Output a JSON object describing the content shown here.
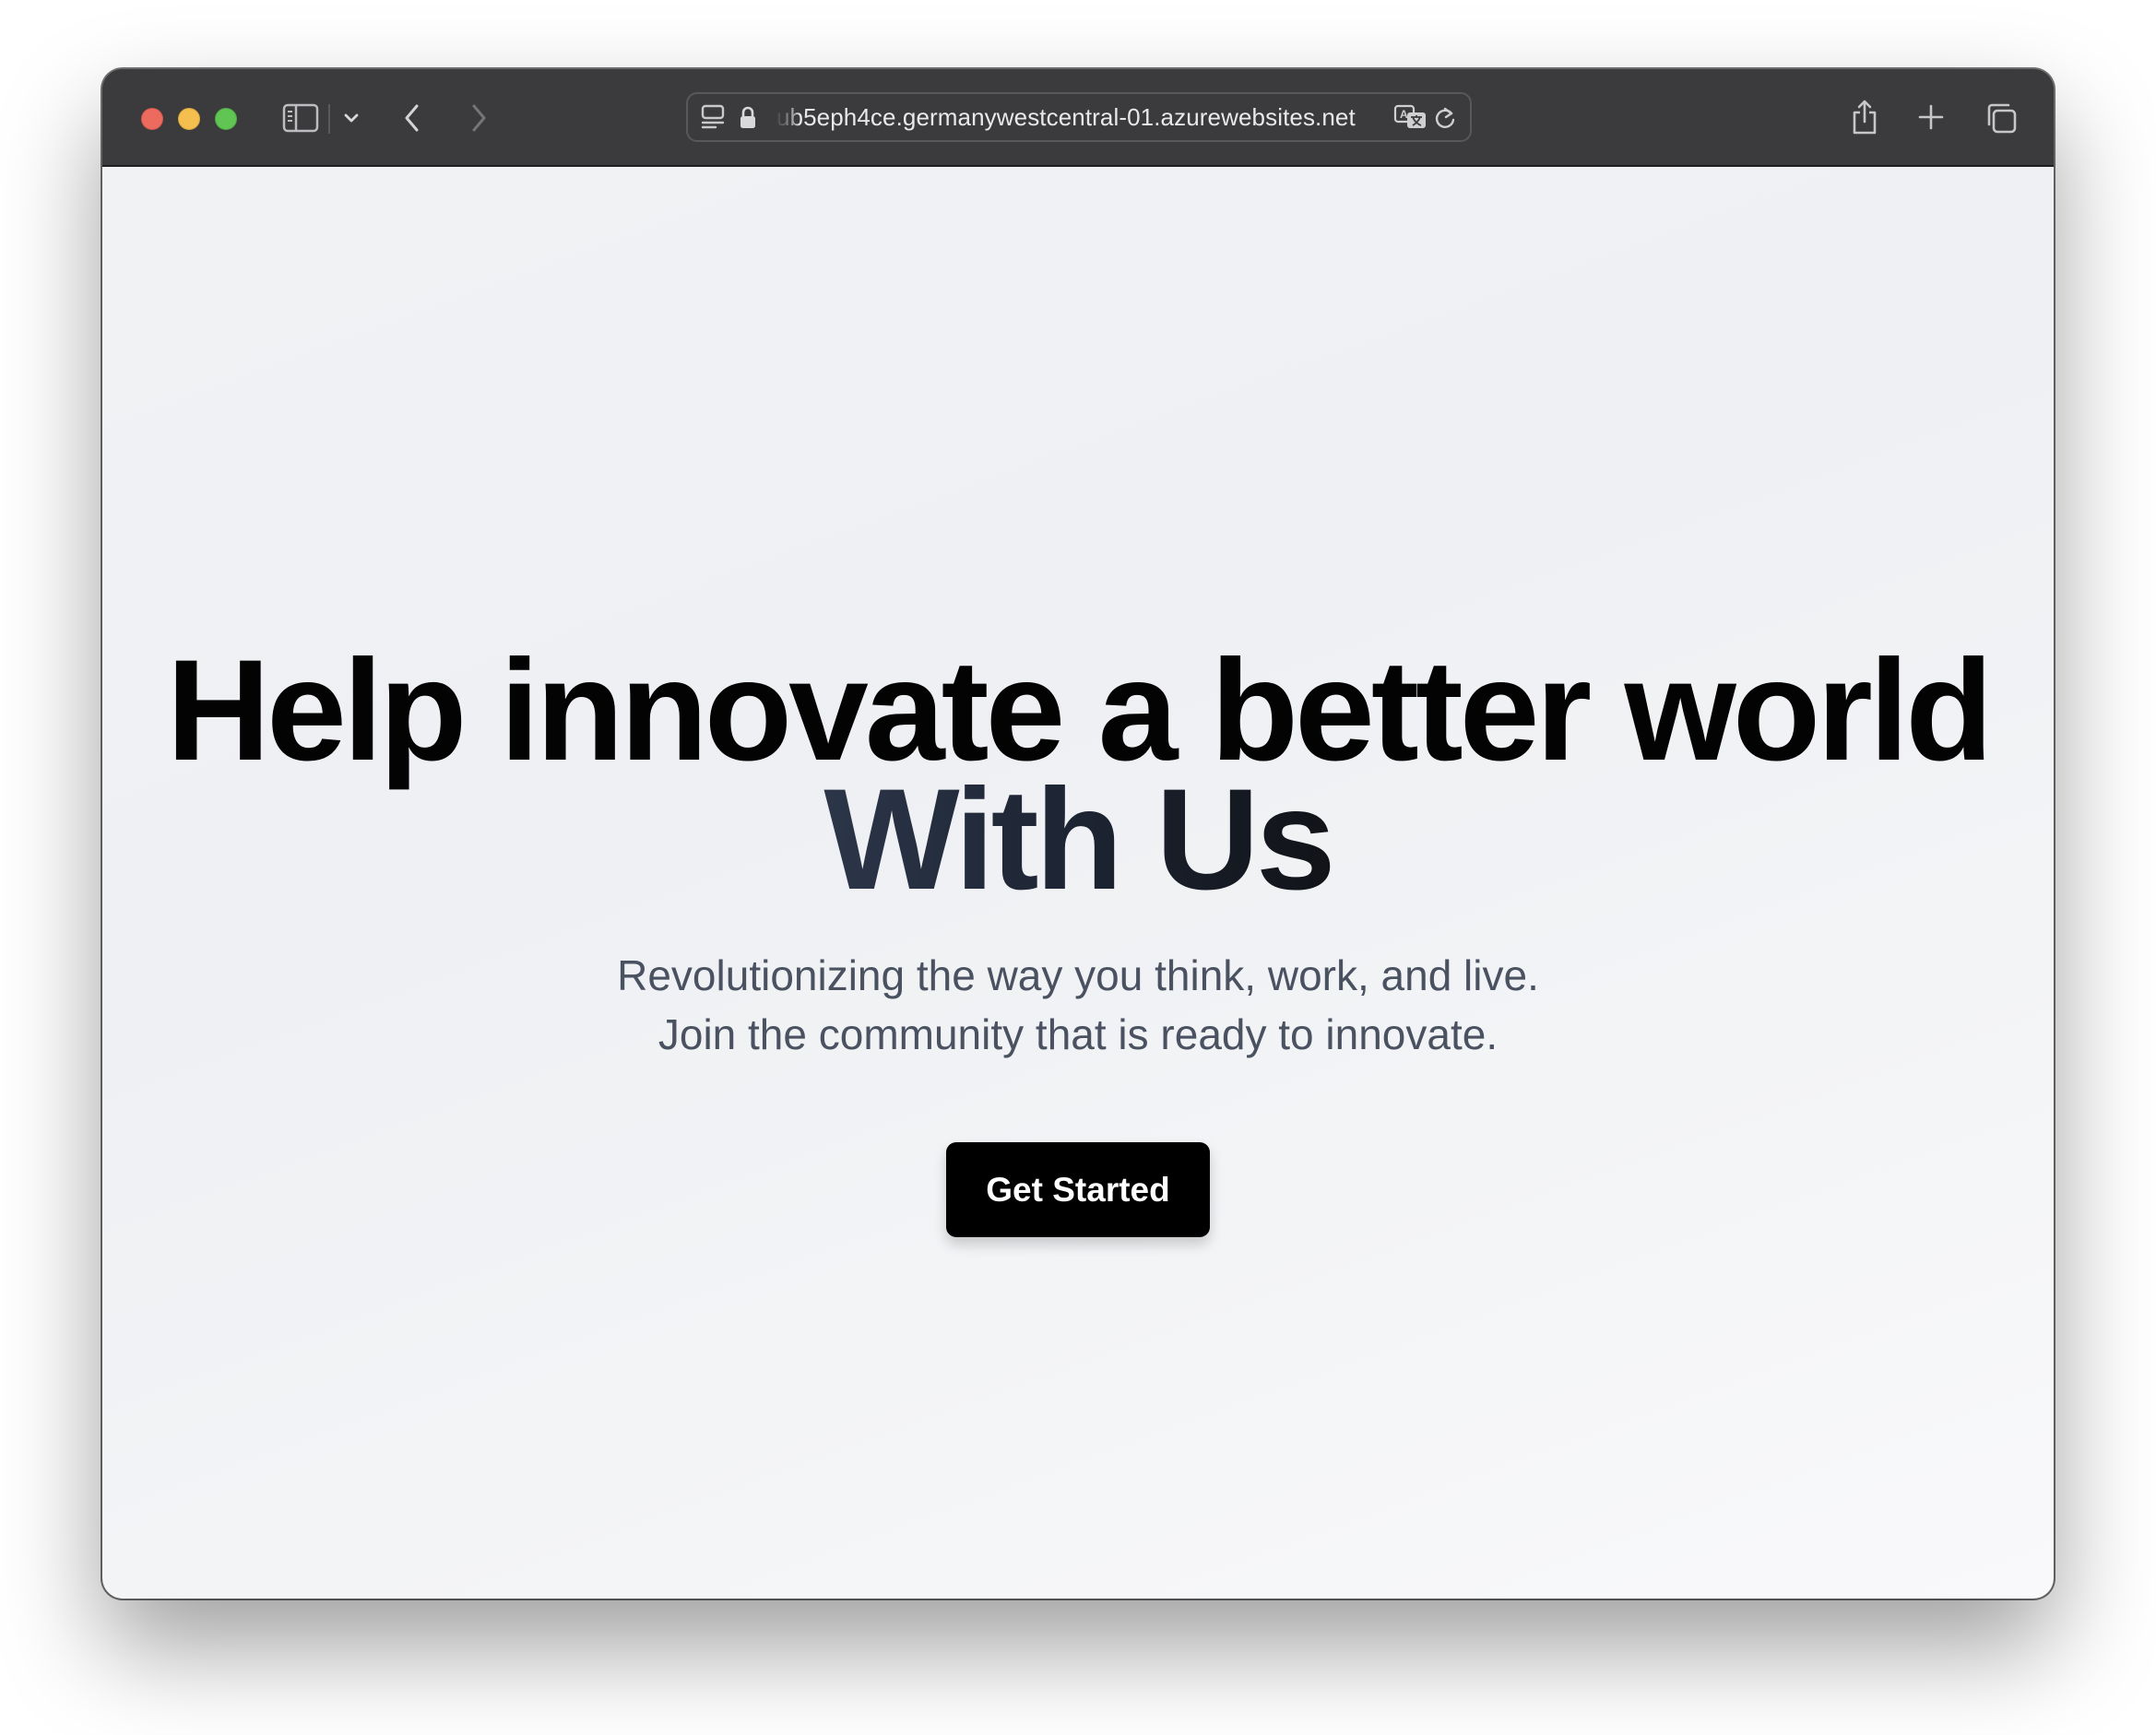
{
  "browser": {
    "url": "ub5eph4ce.germanywestcentral-01.azurewebsites.net",
    "icons": {
      "sidebar": "sidebar-icon",
      "sidebar_menu": "chevron-down-icon",
      "back": "chevron-left-icon",
      "forward": "chevron-right-icon",
      "page_settings": "page-settings-icon",
      "secure": "lock-icon",
      "translate": "translate-icon",
      "reload": "reload-icon",
      "share": "share-icon",
      "new_tab": "plus-icon",
      "tabs_overview": "tabs-overview-icon"
    },
    "colors": {
      "toolbar": "#3b3b3d",
      "close": "#ed6a5e",
      "minimize": "#f5bf4f",
      "zoom": "#61c554"
    }
  },
  "hero": {
    "headline_line1": "Help innovate a better world",
    "headline_line2": "With Us",
    "subtitle": "Revolutionizing the way you think, work, and live. Join the community that is ready to innovate.",
    "cta_label": "Get Started",
    "colors": {
      "headline": "#030303",
      "headline_gradient_start": "#2c3649",
      "subtitle": "#4a5261",
      "cta_background": "#000000",
      "cta_text": "#ffffff"
    }
  }
}
